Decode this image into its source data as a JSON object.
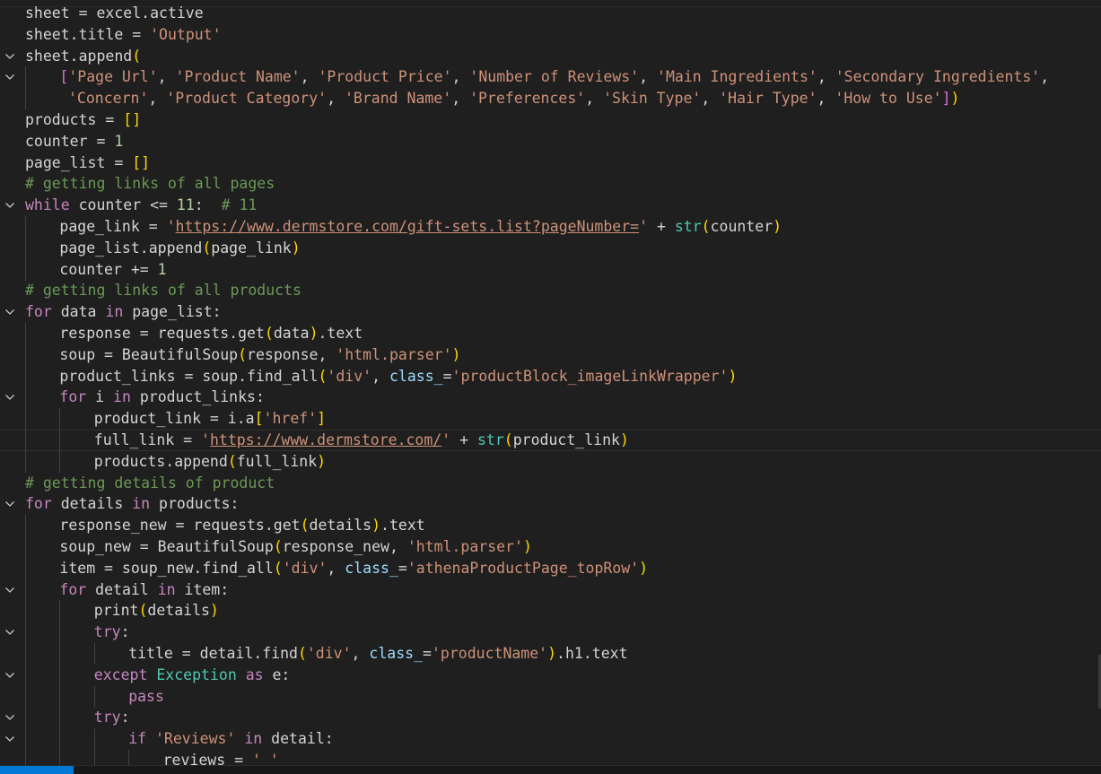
{
  "editor": {
    "current_line_index": 20,
    "lines": [
      {
        "indent": 0,
        "fold": false,
        "tokens": [
          [
            "sheet = excel.active",
            ""
          ]
        ]
      },
      {
        "indent": 0,
        "fold": false,
        "tokens": [
          [
            "sheet.title = ",
            ""
          ],
          [
            "'Output'",
            "str"
          ]
        ]
      },
      {
        "indent": 0,
        "fold": true,
        "tokens": [
          [
            "sheet.append",
            ""
          ],
          [
            "(",
            "b1"
          ]
        ]
      },
      {
        "indent": 1,
        "fold": true,
        "tokens": [
          [
            "[",
            "b2"
          ],
          [
            "'Page Url'",
            "str"
          ],
          [
            ", ",
            ""
          ],
          [
            "'Product Name'",
            "str"
          ],
          [
            ", ",
            ""
          ],
          [
            "'Product Price'",
            "str"
          ],
          [
            ", ",
            ""
          ],
          [
            "'Number of Reviews'",
            "str"
          ],
          [
            ", ",
            ""
          ],
          [
            "'Main Ingredients'",
            "str"
          ],
          [
            ", ",
            ""
          ],
          [
            "'Secondary Ingredients'",
            "str"
          ],
          [
            ",",
            ""
          ]
        ]
      },
      {
        "indent": 1,
        "fold": false,
        "pad": 1,
        "tokens": [
          [
            "'Concern'",
            "str"
          ],
          [
            ", ",
            ""
          ],
          [
            "'Product Category'",
            "str"
          ],
          [
            ", ",
            ""
          ],
          [
            "'Brand Name'",
            "str"
          ],
          [
            ", ",
            ""
          ],
          [
            "'Preferences'",
            "str"
          ],
          [
            ", ",
            ""
          ],
          [
            "'Skin Type'",
            "str"
          ],
          [
            ", ",
            ""
          ],
          [
            "'Hair Type'",
            "str"
          ],
          [
            ", ",
            ""
          ],
          [
            "'How to Use'",
            "str"
          ],
          [
            "]",
            "b2"
          ],
          [
            ")",
            "b1"
          ]
        ]
      },
      {
        "indent": 0,
        "fold": false,
        "tokens": [
          [
            "products = ",
            ""
          ],
          [
            "[]",
            "b1"
          ]
        ]
      },
      {
        "indent": 0,
        "fold": false,
        "tokens": [
          [
            "counter = ",
            ""
          ],
          [
            "1",
            "num"
          ]
        ]
      },
      {
        "indent": 0,
        "fold": false,
        "tokens": [
          [
            "page_list = ",
            ""
          ],
          [
            "[]",
            "b1"
          ]
        ]
      },
      {
        "indent": 0,
        "fold": false,
        "tokens": [
          [
            "# getting links of all pages",
            "cmt"
          ]
        ]
      },
      {
        "indent": 0,
        "fold": true,
        "tokens": [
          [
            "while",
            "ctl"
          ],
          [
            " counter <= ",
            ""
          ],
          [
            "11",
            "num"
          ],
          [
            ":  ",
            ""
          ],
          [
            "# 11",
            "cmt"
          ]
        ]
      },
      {
        "indent": 1,
        "fold": false,
        "tokens": [
          [
            "page_link = ",
            ""
          ],
          [
            "'",
            "str"
          ],
          [
            "https://www.dermstore.com/gift-sets.list?pageNumber=",
            "str url"
          ],
          [
            "'",
            "str"
          ],
          [
            " + ",
            ""
          ],
          [
            "str",
            "cls"
          ],
          [
            "(",
            "b1"
          ],
          [
            "counter",
            ""
          ],
          [
            ")",
            "b1"
          ]
        ]
      },
      {
        "indent": 1,
        "fold": false,
        "tokens": [
          [
            "page_list.append",
            ""
          ],
          [
            "(",
            "b1"
          ],
          [
            "page_link",
            ""
          ],
          [
            ")",
            "b1"
          ]
        ]
      },
      {
        "indent": 1,
        "fold": false,
        "tokens": [
          [
            "counter += ",
            ""
          ],
          [
            "1",
            "num"
          ]
        ]
      },
      {
        "indent": 0,
        "fold": false,
        "tokens": [
          [
            "# getting links of all products",
            "cmt"
          ]
        ]
      },
      {
        "indent": 0,
        "fold": true,
        "tokens": [
          [
            "for",
            "ctl"
          ],
          [
            " data ",
            ""
          ],
          [
            "in",
            "ctl"
          ],
          [
            " page_list:",
            ""
          ]
        ]
      },
      {
        "indent": 1,
        "fold": false,
        "tokens": [
          [
            "response = requests.get",
            ""
          ],
          [
            "(",
            "b1"
          ],
          [
            "data",
            ""
          ],
          [
            ")",
            "b1"
          ],
          [
            ".text",
            ""
          ]
        ]
      },
      {
        "indent": 1,
        "fold": false,
        "tokens": [
          [
            "soup = BeautifulSoup",
            ""
          ],
          [
            "(",
            "b1"
          ],
          [
            "response, ",
            ""
          ],
          [
            "'html.parser'",
            "str"
          ],
          [
            ")",
            "b1"
          ]
        ]
      },
      {
        "indent": 1,
        "fold": false,
        "tokens": [
          [
            "product_links = soup.find_all",
            ""
          ],
          [
            "(",
            "b1"
          ],
          [
            "'div'",
            "str"
          ],
          [
            ", ",
            ""
          ],
          [
            "class_",
            "var"
          ],
          [
            "=",
            ""
          ],
          [
            "'productBlock_imageLinkWrapper'",
            "str"
          ],
          [
            ")",
            "b1"
          ]
        ]
      },
      {
        "indent": 1,
        "fold": true,
        "tokens": [
          [
            "for",
            "ctl"
          ],
          [
            " i ",
            ""
          ],
          [
            "in",
            "ctl"
          ],
          [
            " product_links:",
            ""
          ]
        ]
      },
      {
        "indent": 2,
        "fold": false,
        "tokens": [
          [
            "product_link = i.a",
            ""
          ],
          [
            "[",
            "b1"
          ],
          [
            "'href'",
            "str"
          ],
          [
            "]",
            "b1"
          ]
        ]
      },
      {
        "indent": 2,
        "fold": false,
        "tokens": [
          [
            "full_link = ",
            ""
          ],
          [
            "'",
            "str"
          ],
          [
            "https://www.dermstore.com/",
            "str url"
          ],
          [
            "'",
            "str"
          ],
          [
            " + ",
            ""
          ],
          [
            "str",
            "cls"
          ],
          [
            "(",
            "b1"
          ],
          [
            "product_link",
            ""
          ],
          [
            ")",
            "b1"
          ]
        ]
      },
      {
        "indent": 2,
        "fold": false,
        "tokens": [
          [
            "products.append",
            ""
          ],
          [
            "(",
            "b1"
          ],
          [
            "full_link",
            ""
          ],
          [
            ")",
            "b1"
          ]
        ]
      },
      {
        "indent": 0,
        "fold": false,
        "tokens": [
          [
            "# getting details of product",
            "cmt"
          ]
        ]
      },
      {
        "indent": 0,
        "fold": true,
        "tokens": [
          [
            "for",
            "ctl"
          ],
          [
            " details ",
            ""
          ],
          [
            "in",
            "ctl"
          ],
          [
            " products:",
            ""
          ]
        ]
      },
      {
        "indent": 1,
        "fold": false,
        "tokens": [
          [
            "response_new = requests.get",
            ""
          ],
          [
            "(",
            "b1"
          ],
          [
            "details",
            ""
          ],
          [
            ")",
            "b1"
          ],
          [
            ".text",
            ""
          ]
        ]
      },
      {
        "indent": 1,
        "fold": false,
        "tokens": [
          [
            "soup_new = BeautifulSoup",
            ""
          ],
          [
            "(",
            "b1"
          ],
          [
            "response_new, ",
            ""
          ],
          [
            "'html.parser'",
            "str"
          ],
          [
            ")",
            "b1"
          ]
        ]
      },
      {
        "indent": 1,
        "fold": false,
        "tokens": [
          [
            "item = soup_new.find_all",
            ""
          ],
          [
            "(",
            "b1"
          ],
          [
            "'div'",
            "str"
          ],
          [
            ", ",
            ""
          ],
          [
            "class_",
            "var"
          ],
          [
            "=",
            ""
          ],
          [
            "'athenaProductPage_topRow'",
            "str"
          ],
          [
            ")",
            "b1"
          ]
        ]
      },
      {
        "indent": 1,
        "fold": true,
        "tokens": [
          [
            "for",
            "ctl"
          ],
          [
            " detail ",
            ""
          ],
          [
            "in",
            "ctl"
          ],
          [
            " item:",
            ""
          ]
        ]
      },
      {
        "indent": 2,
        "fold": false,
        "tokens": [
          [
            "print",
            ""
          ],
          [
            "(",
            "b1"
          ],
          [
            "details",
            ""
          ],
          [
            ")",
            "b1"
          ]
        ]
      },
      {
        "indent": 2,
        "fold": true,
        "tokens": [
          [
            "try",
            "ctl"
          ],
          [
            ":",
            ""
          ]
        ]
      },
      {
        "indent": 3,
        "fold": false,
        "tokens": [
          [
            "title = detail.find",
            ""
          ],
          [
            "(",
            "b1"
          ],
          [
            "'div'",
            "str"
          ],
          [
            ", ",
            ""
          ],
          [
            "class_",
            "var"
          ],
          [
            "=",
            ""
          ],
          [
            "'productName'",
            "str"
          ],
          [
            ")",
            "b1"
          ],
          [
            ".h1.text",
            ""
          ]
        ]
      },
      {
        "indent": 2,
        "fold": true,
        "tokens": [
          [
            "except",
            "ctl"
          ],
          [
            " ",
            ""
          ],
          [
            "Exception",
            "cls"
          ],
          [
            " ",
            ""
          ],
          [
            "as",
            "ctl"
          ],
          [
            " e:",
            ""
          ]
        ]
      },
      {
        "indent": 3,
        "fold": false,
        "tokens": [
          [
            "pass",
            "ctl"
          ]
        ]
      },
      {
        "indent": 2,
        "fold": true,
        "tokens": [
          [
            "try",
            "ctl"
          ],
          [
            ":",
            ""
          ]
        ]
      },
      {
        "indent": 3,
        "fold": true,
        "tokens": [
          [
            "if",
            "ctl"
          ],
          [
            " ",
            ""
          ],
          [
            "'Reviews'",
            "str"
          ],
          [
            " ",
            ""
          ],
          [
            "in",
            "ctl"
          ],
          [
            " detail:",
            ""
          ]
        ]
      },
      {
        "indent": 4,
        "fold": false,
        "tokens": [
          [
            "reviews = ",
            ""
          ],
          [
            "' '",
            "str"
          ]
        ]
      }
    ]
  },
  "colors": {
    "background": "#1f1f1f",
    "default_text": "#d4d4d4",
    "string": "#ce9178",
    "keyword": "#c586c0",
    "number": "#b5cea8",
    "comment": "#6a9955",
    "class": "#4ec9b0",
    "bracket_gold": "#ffd700",
    "bracket_orchid": "#da70d6",
    "status_accent": "#0078d4"
  },
  "icons": {
    "fold": "chevron-down-icon"
  },
  "statusbar": {
    "mode_label": "",
    "problems": "",
    "ports": ""
  }
}
